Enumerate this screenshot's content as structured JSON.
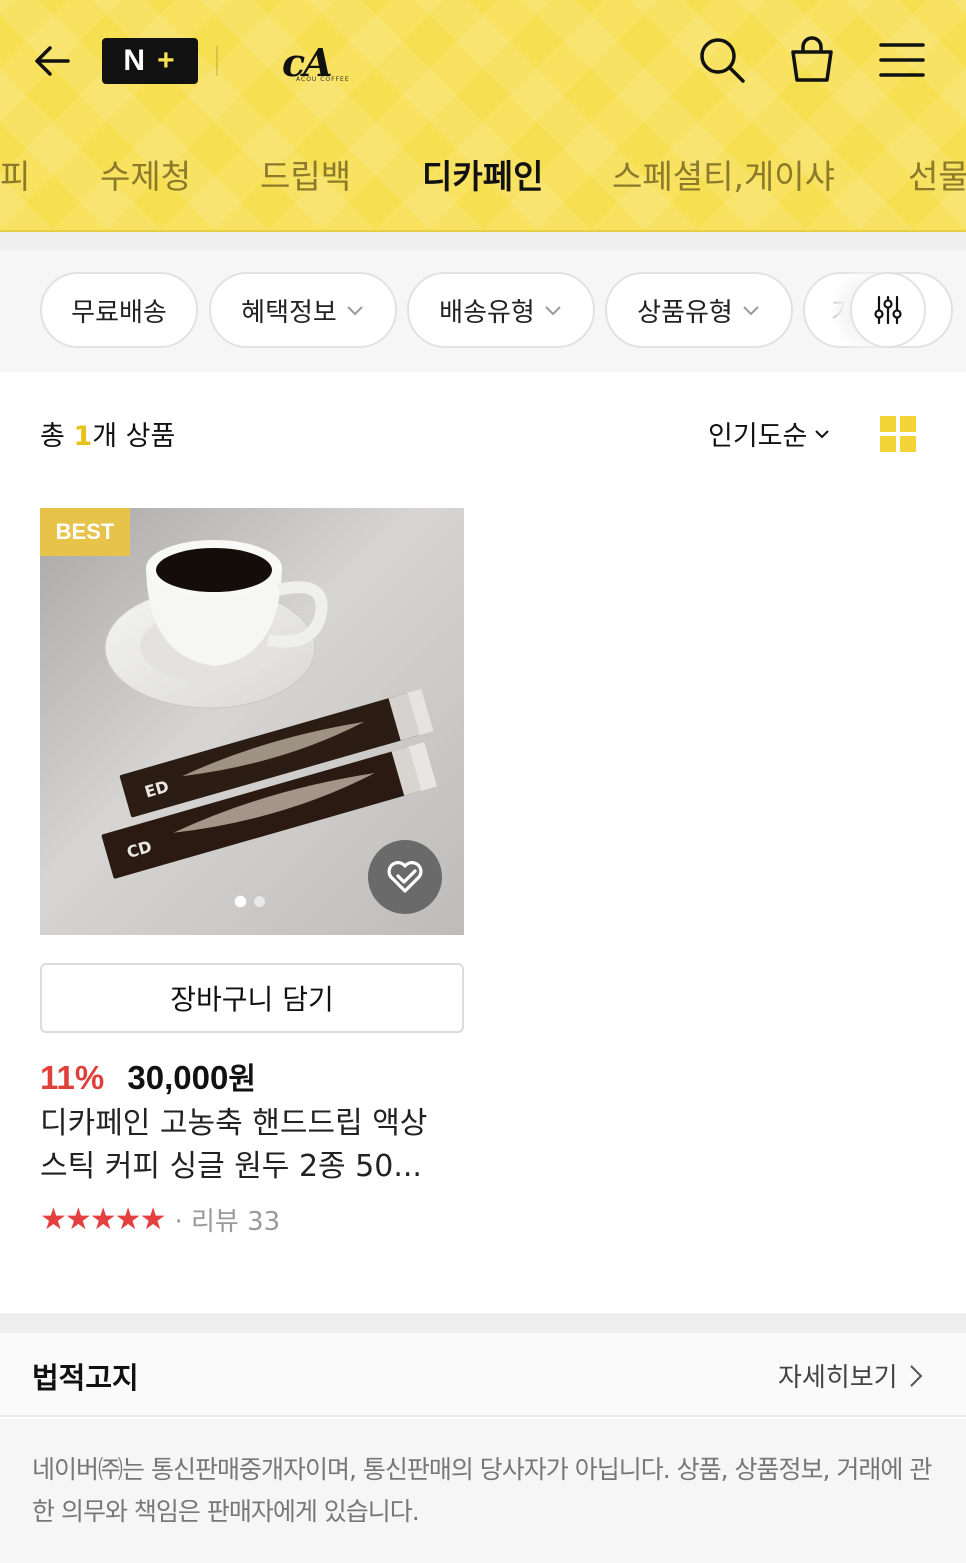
{
  "header": {
    "nplus_logo_text": "N+",
    "brand_logo_text": "cA",
    "brand_logo_sub": "ACOU COFFEE",
    "icons": [
      "back-arrow-icon",
      "search-icon",
      "shopping-bag-icon",
      "hamburger-menu-icon"
    ],
    "background_color": "#f7df52"
  },
  "categories": {
    "tabs": [
      {
        "label": "피",
        "active": false
      },
      {
        "label": "수제청",
        "active": false
      },
      {
        "label": "드립백",
        "active": false
      },
      {
        "label": "디카페인",
        "active": true
      },
      {
        "label": "스페셜티,게이샤",
        "active": false
      },
      {
        "label": "선물",
        "active": false
      }
    ]
  },
  "filters": {
    "chips": [
      "무료배송",
      "혜택정보",
      "배송유형",
      "상품유형",
      "가"
    ],
    "settings_icon": "filter-sliders-icon"
  },
  "summary": {
    "prefix": "총 ",
    "count": "1",
    "suffix": "개 상품",
    "sort_label": "인기도순",
    "grid_toggle_icon": "grid-view-icon",
    "accent_color": "#e8c21a"
  },
  "products": [
    {
      "badge": "BEST",
      "image_dots": 2,
      "active_dot": 0,
      "add_to_cart_label": "장바구니 담기",
      "discount": "11%",
      "price": "30,000",
      "currency": "원",
      "title": "디카페인 고농축 핸드드립 액상 스틱 커피 싱글 원두 2종 50...",
      "rating": 5,
      "stars_text": "★★★★★",
      "review_text": "· 리뷰 33",
      "discount_color": "#e0403a",
      "star_color": "#e44040"
    }
  ],
  "legal": {
    "title": "법적고지",
    "more_label": "자세히보기",
    "text": "네이버㈜는 통신판매중개자이며, 통신판매의 당사자가 아닙니다. 상품, 상품정보, 거래에 관한 의무와 책임은 판매자에게 있습니다."
  }
}
